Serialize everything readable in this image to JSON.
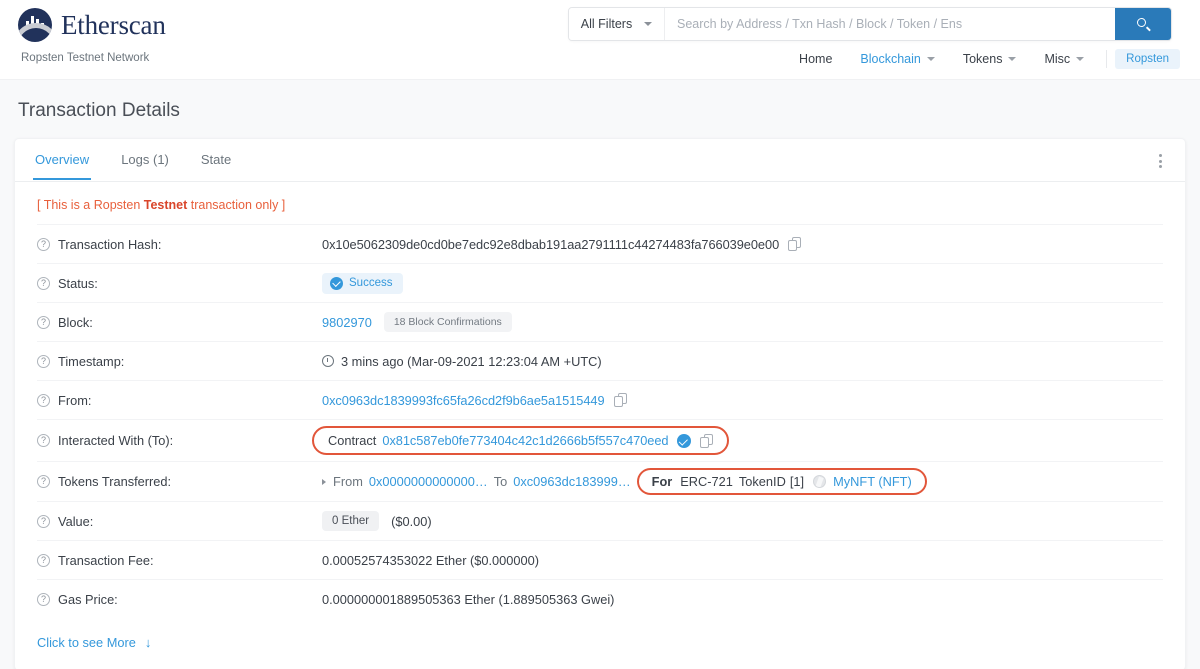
{
  "header": {
    "brand_name": "Etherscan",
    "network_label": "Ropsten Testnet Network",
    "search": {
      "filter_label": "All Filters",
      "placeholder": "Search by Address / Txn Hash / Block / Token / Ens",
      "value": "",
      "button_icon": "search-icon"
    },
    "nav": [
      {
        "label": "Home",
        "has_caret": false,
        "active": false
      },
      {
        "label": "Blockchain",
        "has_caret": true,
        "active": true
      },
      {
        "label": "Tokens",
        "has_caret": true,
        "active": false
      },
      {
        "label": "Misc",
        "has_caret": true,
        "active": false
      }
    ],
    "network_badge": "Ropsten"
  },
  "page_title": "Transaction Details",
  "tabs": [
    {
      "label": "Overview",
      "active": true
    },
    {
      "label": "Logs (1)",
      "active": false
    },
    {
      "label": "State",
      "active": false
    }
  ],
  "kebab_icon": "more-vertical-icon",
  "testnet_note": {
    "prefix": "[ This is a Ropsten ",
    "emphasis": "Testnet",
    "suffix": " transaction only ]"
  },
  "rows": {
    "txn_hash": {
      "label": "Transaction Hash:",
      "value": "0x10e5062309de0cd0be7edc92e8dbab191aa2791111c44274483fa766039e0e00"
    },
    "status": {
      "label": "Status:",
      "value": "Success"
    },
    "block": {
      "label": "Block:",
      "number": "9802970",
      "confirmations": "18 Block Confirmations"
    },
    "timestamp": {
      "label": "Timestamp:",
      "value": "3 mins ago (Mar-09-2021 12:23:04 AM +UTC)"
    },
    "from": {
      "label": "From:",
      "value": "0xc0963dc1839993fc65fa26cd2f9b6ae5a1515449"
    },
    "interacted_with": {
      "label": "Interacted With (To):",
      "prefix": "Contract",
      "address": "0x81c587eb0fe773404c42c1d2666b5f557c470eed"
    },
    "tokens_transferred": {
      "label": "Tokens Transferred:",
      "from_label": "From",
      "from_value": "0x0000000000000…",
      "to_label": "To",
      "to_value": "0xc0963dc183999…",
      "for_label": "For",
      "token_standard": "ERC-721",
      "token_id_label": "TokenID",
      "token_id": "[1]",
      "token_name": "MyNFT (NFT)"
    },
    "value": {
      "label": "Value:",
      "ether": "0 Ether",
      "usd": "($0.00)"
    },
    "txn_fee": {
      "label": "Transaction Fee:",
      "value": "0.00052574353022 Ether ($0.000000)"
    },
    "gas_price": {
      "label": "Gas Price:",
      "value": "0.000000001889505363 Ether (1.889505363 Gwei)"
    }
  },
  "more_link": {
    "label": "Click to see More",
    "arrow": "↓"
  },
  "colors": {
    "accent_blue": "#3498db",
    "brand_navy": "#21325b",
    "testnet_red": "#e8603c",
    "highlight_red": "#e2563a",
    "page_bg": "#f8f9fa"
  }
}
